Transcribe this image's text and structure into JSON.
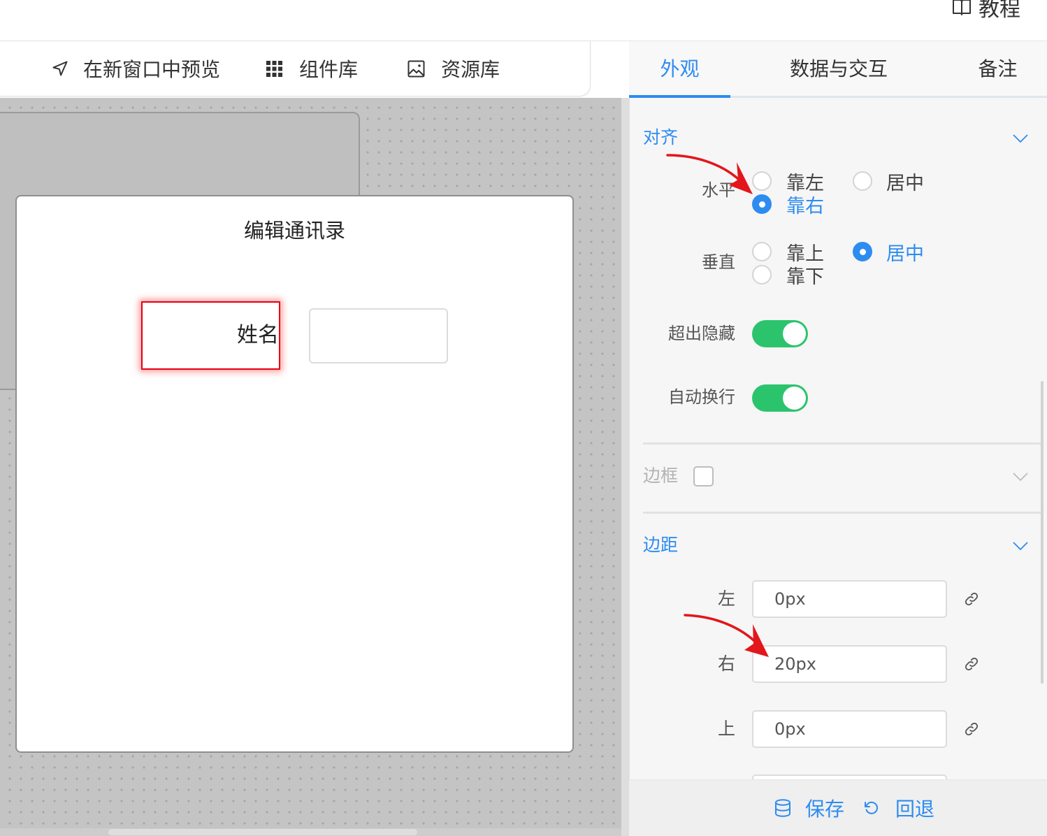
{
  "header": {
    "tutorial": {
      "label": "教程",
      "icon": "book-icon"
    }
  },
  "toolbar": {
    "preview": {
      "label": "在新窗口中预览",
      "icon": "navigation-icon"
    },
    "components": {
      "label": "组件库",
      "icon": "grid-icon"
    },
    "assets": {
      "label": "资源库",
      "icon": "image-icon"
    }
  },
  "canvas": {
    "dialog": {
      "title": "编辑通讯录",
      "name_label": "姓名"
    }
  },
  "panel": {
    "tabs": [
      {
        "label": "外观",
        "active": true
      },
      {
        "label": "数据与交互",
        "active": false
      },
      {
        "label": "备注",
        "active": false
      }
    ],
    "align": {
      "title": "对齐",
      "horizontal": {
        "label": "水平",
        "options": [
          {
            "label": "靠左",
            "checked": false
          },
          {
            "label": "居中",
            "checked": false
          },
          {
            "label": "靠右",
            "checked": true
          }
        ]
      },
      "vertical": {
        "label": "垂直",
        "options": [
          {
            "label": "靠上",
            "checked": false
          },
          {
            "label": "居中",
            "checked": true
          },
          {
            "label": "靠下",
            "checked": false
          }
        ]
      },
      "overflow_hidden": {
        "label": "超出隐藏",
        "on": true
      },
      "auto_wrap": {
        "label": "自动换行",
        "on": true
      }
    },
    "border": {
      "title": "边框",
      "enabled": false
    },
    "margin": {
      "title": "边距",
      "fields": [
        {
          "label": "左",
          "value": "0px"
        },
        {
          "label": "右",
          "value": "20px"
        },
        {
          "label": "上",
          "value": "0px"
        }
      ]
    },
    "footer": {
      "save": {
        "label": "保存",
        "icon": "database-icon"
      },
      "revert": {
        "label": "回退",
        "icon": "undo-icon"
      }
    }
  },
  "colors": {
    "accent": "#2d8cf0",
    "toggle_on": "#2bc46d",
    "selection_border": "#e60012",
    "annotation": "#e3161b"
  }
}
